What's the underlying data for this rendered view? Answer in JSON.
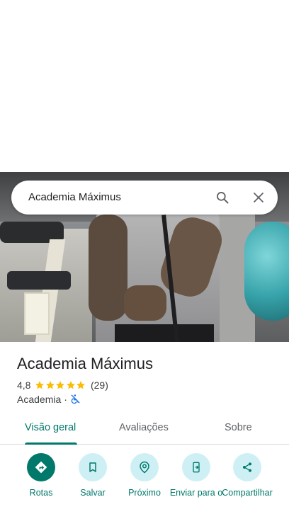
{
  "search": {
    "query": "Academia Máximus"
  },
  "place": {
    "name": "Academia Máximus",
    "rating": "4,8",
    "stars": 5,
    "review_count": "(29)",
    "category": "Academia",
    "separator": "·"
  },
  "tabs": [
    {
      "label": "Visão geral",
      "active": true
    },
    {
      "label": "Avaliações",
      "active": false
    },
    {
      "label": "Sobre",
      "active": false
    }
  ],
  "actions": [
    {
      "label": "Rotas",
      "icon": "directions-icon"
    },
    {
      "label": "Salvar",
      "icon": "bookmark-icon"
    },
    {
      "label": "Próximo",
      "icon": "nearby-icon"
    },
    {
      "label": "Enviar para o",
      "icon": "send-to-phone-icon"
    },
    {
      "label": "Compartilhar",
      "icon": "share-icon"
    }
  ],
  "colors": {
    "accent": "#00796b",
    "accent_light": "#cef0f4",
    "star": "#fbbc04",
    "text_primary": "#202124",
    "text_secondary": "#3c4043"
  }
}
